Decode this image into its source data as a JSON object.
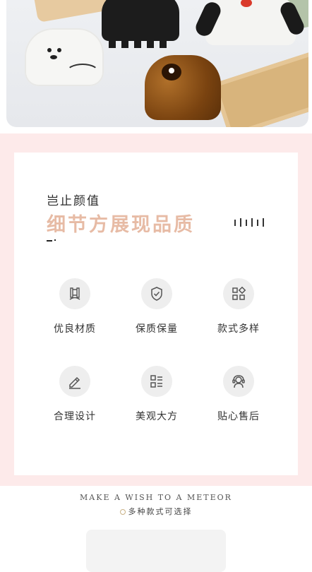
{
  "hero": {
    "image_name": "hair-claw-clips-photo"
  },
  "panel": {
    "heading_small": "岂止颜值",
    "heading_big": "细节方展现品质",
    "mini_mark": "一·",
    "features": [
      {
        "label": "优良材质",
        "icon": "material-icon"
      },
      {
        "label": "保质保量",
        "icon": "shield-check-icon"
      },
      {
        "label": "款式多样",
        "icon": "grid-shapes-icon"
      },
      {
        "label": "合理设计",
        "icon": "pencil-icon"
      },
      {
        "label": "美观大方",
        "icon": "list-grid-icon"
      },
      {
        "label": "贴心售后",
        "icon": "headset-icon"
      }
    ]
  },
  "footer": {
    "wish": "MAKE A WISH TO A METEOR",
    "choice": "多种款式可选择"
  },
  "colors": {
    "panel_bg": "#fdeaea",
    "accent_text": "#e7bba5",
    "icon_circle": "#eeeeee"
  }
}
